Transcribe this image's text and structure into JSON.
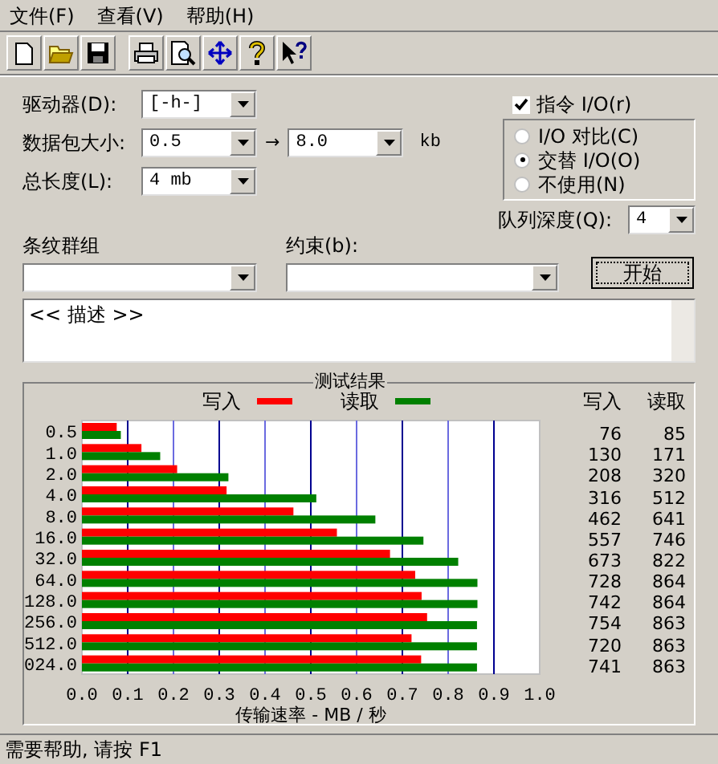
{
  "menu": [
    {
      "label": "文件(F)"
    },
    {
      "label": "查看(V)"
    },
    {
      "label": "帮助(H)"
    }
  ],
  "toolbar": [
    {
      "kind": "new"
    },
    {
      "kind": "open"
    },
    {
      "kind": "save"
    },
    {
      "kind": "separator"
    },
    {
      "kind": "print"
    },
    {
      "kind": "preview"
    },
    {
      "kind": "move"
    },
    {
      "kind": "help"
    },
    {
      "kind": "context_help"
    }
  ],
  "form": {
    "drive": {
      "label": "驱动器(D):",
      "value": "[-h-]"
    },
    "transfer_size": {
      "label": "数据包大小:",
      "from": "0.5",
      "arrow": "→",
      "to": "8.0",
      "unit": "kb"
    },
    "total_length": {
      "label": "总长度(L):",
      "value": "4 mb"
    },
    "direct_io": {
      "label": "指令 I/O(r)",
      "checked": true
    },
    "io_modes": [
      {
        "label": "I/O 对比(C)",
        "selected": false
      },
      {
        "label": "交替 I/O(O)",
        "selected": true
      },
      {
        "label": "不使用(N)",
        "selected": false
      }
    ],
    "queue_depth": {
      "label": "队列深度(Q):",
      "value": "4"
    },
    "stripe_group": {
      "label": "条纹群组"
    },
    "constraint": {
      "label": "约束(b):"
    },
    "start_button": {
      "label": "开始"
    },
    "description": {
      "value": "<< 描述 >>"
    }
  },
  "results": {
    "title": "测试结果",
    "columns": [
      "写入",
      "读取"
    ],
    "rows": [
      {
        "write": "76",
        "read": "85"
      },
      {
        "write": "130",
        "read": "171"
      },
      {
        "write": "208",
        "read": "320"
      },
      {
        "write": "316",
        "read": "512"
      },
      {
        "write": "462",
        "read": "641"
      },
      {
        "write": "557",
        "read": "746"
      },
      {
        "write": "673",
        "read": "822"
      },
      {
        "write": "728",
        "read": "864"
      },
      {
        "write": "742",
        "read": "864"
      },
      {
        "write": "754",
        "read": "863"
      },
      {
        "write": "720",
        "read": "863"
      },
      {
        "write": "741",
        "read": "863"
      }
    ],
    "chart_data": {
      "type": "bar",
      "orientation": "horizontal",
      "xlabel": "传输速率 - MB / 秒",
      "categories": [
        "0.5",
        "1.0",
        "2.0",
        "4.0",
        "8.0",
        "16.0",
        "32.0",
        "64.0",
        "128.0",
        "256.0",
        "512.0",
        "024.0"
      ],
      "series": [
        {
          "name": "写入",
          "color": "#ff0000",
          "values": [
            0.076,
            0.13,
            0.208,
            0.316,
            0.462,
            0.557,
            0.673,
            0.728,
            0.742,
            0.754,
            0.72,
            0.741
          ]
        },
        {
          "name": "读取",
          "color": "#008000",
          "values": [
            0.085,
            0.171,
            0.32,
            0.512,
            0.641,
            0.746,
            0.822,
            0.864,
            0.864,
            0.863,
            0.863,
            0.863
          ]
        }
      ],
      "xlim": [
        0,
        1
      ],
      "grid": true,
      "xticks": [
        {
          "value": 0,
          "label": "0.0"
        },
        {
          "value": 0.1,
          "label": "0.1"
        },
        {
          "value": 0.2,
          "label": "0.2"
        },
        {
          "value": 0.3,
          "label": "0.3"
        },
        {
          "value": 0.4,
          "label": "0.4"
        },
        {
          "value": 0.5,
          "label": "0.5"
        },
        {
          "value": 0.6,
          "label": "0.6"
        },
        {
          "value": 0.7,
          "label": "0.7"
        },
        {
          "value": 0.8,
          "label": "0.8"
        },
        {
          "value": 0.9,
          "label": "0.9"
        },
        {
          "value": 1,
          "label": "1.0"
        }
      ]
    }
  },
  "status_bar": {
    "text": "需要帮助, 请按 F1"
  }
}
